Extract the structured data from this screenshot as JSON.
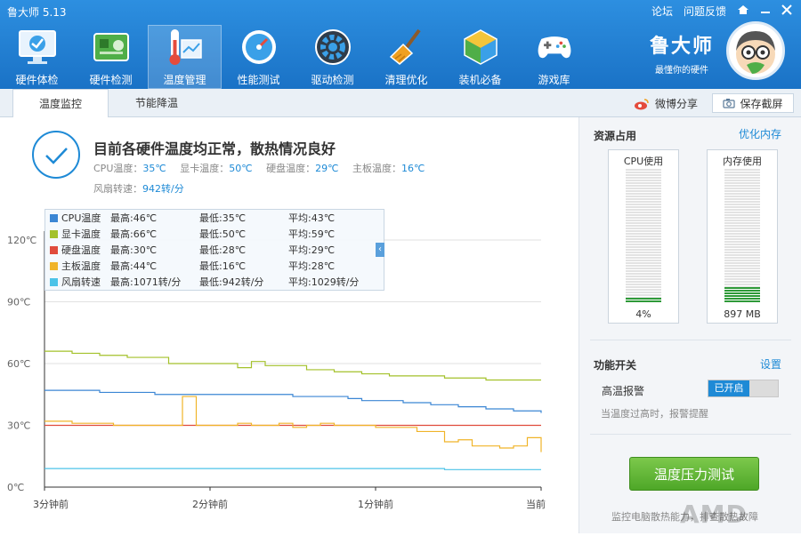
{
  "app": {
    "title": "鲁大师 5.13",
    "forum": "论坛",
    "feedback": "问题反馈"
  },
  "nav": [
    {
      "label": "硬件体检",
      "icon": "monitor-icon"
    },
    {
      "label": "硬件检测",
      "icon": "circuit-board-icon"
    },
    {
      "label": "温度管理",
      "icon": "thermometer-icon"
    },
    {
      "label": "性能测试",
      "icon": "speedometer-icon"
    },
    {
      "label": "驱动检测",
      "icon": "gear-icon"
    },
    {
      "label": "清理优化",
      "icon": "broom-icon"
    },
    {
      "label": "装机必备",
      "icon": "box-icon"
    },
    {
      "label": "游戏库",
      "icon": "gamepad-icon"
    }
  ],
  "brand": {
    "name": "鲁大师",
    "slogan": "最懂你的硬件"
  },
  "tabs": {
    "monitor": "温度监控",
    "saving": "节能降温"
  },
  "actions": {
    "share": "微博分享",
    "save": "保存截屏"
  },
  "status": {
    "title": "目前各硬件温度均正常，散热情况良好",
    "cpu_label": "CPU温度：",
    "cpu_value": "35℃",
    "gpu_label": "显卡温度：",
    "gpu_value": "50℃",
    "disk_label": "硬盘温度：",
    "disk_value": "29℃",
    "board_label": "主板温度：",
    "board_value": "16℃",
    "fan_label": "风扇转速：",
    "fan_value": "942转/分"
  },
  "legend": [
    {
      "name": "CPU温度",
      "max": "最高:46℃",
      "min": "最低:35℃",
      "avg": "平均:43℃",
      "color": "#3b86d4"
    },
    {
      "name": "显卡温度",
      "max": "最高:66℃",
      "min": "最低:50℃",
      "avg": "平均:59℃",
      "color": "#a3c12a"
    },
    {
      "name": "硬盘温度",
      "max": "最高:30℃",
      "min": "最低:28℃",
      "avg": "平均:29℃",
      "color": "#e04b3c"
    },
    {
      "name": "主板温度",
      "max": "最高:44℃",
      "min": "最低:16℃",
      "avg": "平均:28℃",
      "color": "#f0b429"
    },
    {
      "name": "风扇转速",
      "max": "最高:1071转/分",
      "min": "最低:942转/分",
      "avg": "平均:1029转/分",
      "color": "#4cc3e8"
    }
  ],
  "chart_data": {
    "type": "line",
    "x": [
      0,
      5,
      10,
      15,
      20,
      25,
      30,
      35,
      40,
      45,
      50,
      55,
      60,
      65,
      70,
      75,
      80,
      85,
      90,
      95,
      100,
      105,
      110,
      115,
      120,
      125,
      130,
      135,
      140,
      145,
      150,
      155,
      160,
      165,
      170,
      175,
      180
    ],
    "y_ticks": [
      "120℃",
      "90℃",
      "60℃",
      "30℃",
      "0℃"
    ],
    "x_ticks": [
      "3分钟前",
      "2分钟前",
      "1分钟前",
      "当前"
    ],
    "ylim": [
      0,
      120
    ],
    "grid": true,
    "series": [
      {
        "name": "CPU温度",
        "color": "#3b86d4",
        "values": [
          47,
          47,
          47,
          47,
          46,
          46,
          46,
          46,
          45,
          45,
          45,
          45,
          45,
          45,
          45,
          45,
          45,
          45,
          44,
          44,
          44,
          44,
          43,
          42,
          42,
          42,
          41,
          41,
          40,
          40,
          39,
          39,
          38,
          38,
          37,
          37,
          36
        ]
      },
      {
        "name": "显卡温度",
        "color": "#a3c12a",
        "values": [
          66,
          66,
          65,
          65,
          64,
          64,
          63,
          63,
          63,
          60,
          60,
          60,
          60,
          60,
          58,
          61,
          59,
          59,
          59,
          57,
          57,
          56,
          56,
          55,
          55,
          54,
          54,
          54,
          54,
          53,
          53,
          53,
          52,
          52,
          52,
          52,
          52
        ]
      },
      {
        "name": "硬盘温度",
        "color": "#e04b3c",
        "values": [
          30,
          30,
          30,
          30,
          30,
          30,
          30,
          30,
          30,
          30,
          30,
          30,
          30,
          30,
          30,
          30,
          30,
          30,
          30,
          30,
          30,
          30,
          30,
          30,
          30,
          30,
          30,
          30,
          30,
          30,
          30,
          30,
          30,
          30,
          30,
          30,
          30
        ]
      },
      {
        "name": "主板温度",
        "color": "#f0b429",
        "values": [
          32,
          32,
          31,
          31,
          31,
          30,
          30,
          30,
          30,
          30,
          44,
          30,
          30,
          30,
          31,
          30,
          30,
          31,
          29,
          30,
          31,
          30,
          30,
          30,
          29,
          29,
          29,
          27,
          27,
          22,
          23,
          20,
          20,
          19,
          20,
          24,
          17
        ]
      },
      {
        "name": "风扇转速",
        "color": "#4cc3e8",
        "values": [
          9,
          9,
          9,
          9,
          9,
          9,
          9,
          9,
          9,
          9,
          9,
          9,
          9,
          9,
          9,
          9,
          9,
          9,
          9,
          9,
          9,
          9,
          9,
          9,
          9,
          9,
          9,
          9,
          9,
          8.5,
          8.5,
          8.5,
          8.5,
          8.5,
          8.5,
          8.5,
          8.5
        ]
      }
    ]
  },
  "resources": {
    "title": "资源占用",
    "optimize": "优化内存",
    "cpu_label": "CPU使用",
    "cpu_value": "4%",
    "cpu_level": 0.04,
    "mem_label": "内存使用",
    "mem_value": "897 MB",
    "mem_level": 0.12
  },
  "features": {
    "title": "功能开关",
    "settings": "设置",
    "alarm_label": "高温报警",
    "alarm_state": "已开启",
    "alarm_hint": "当温度过高时，报警提醒"
  },
  "stress_button": "温度压力测试",
  "footer": {
    "text": "监控电脑散热能力，排查散热故障",
    "logo": "AMD"
  }
}
